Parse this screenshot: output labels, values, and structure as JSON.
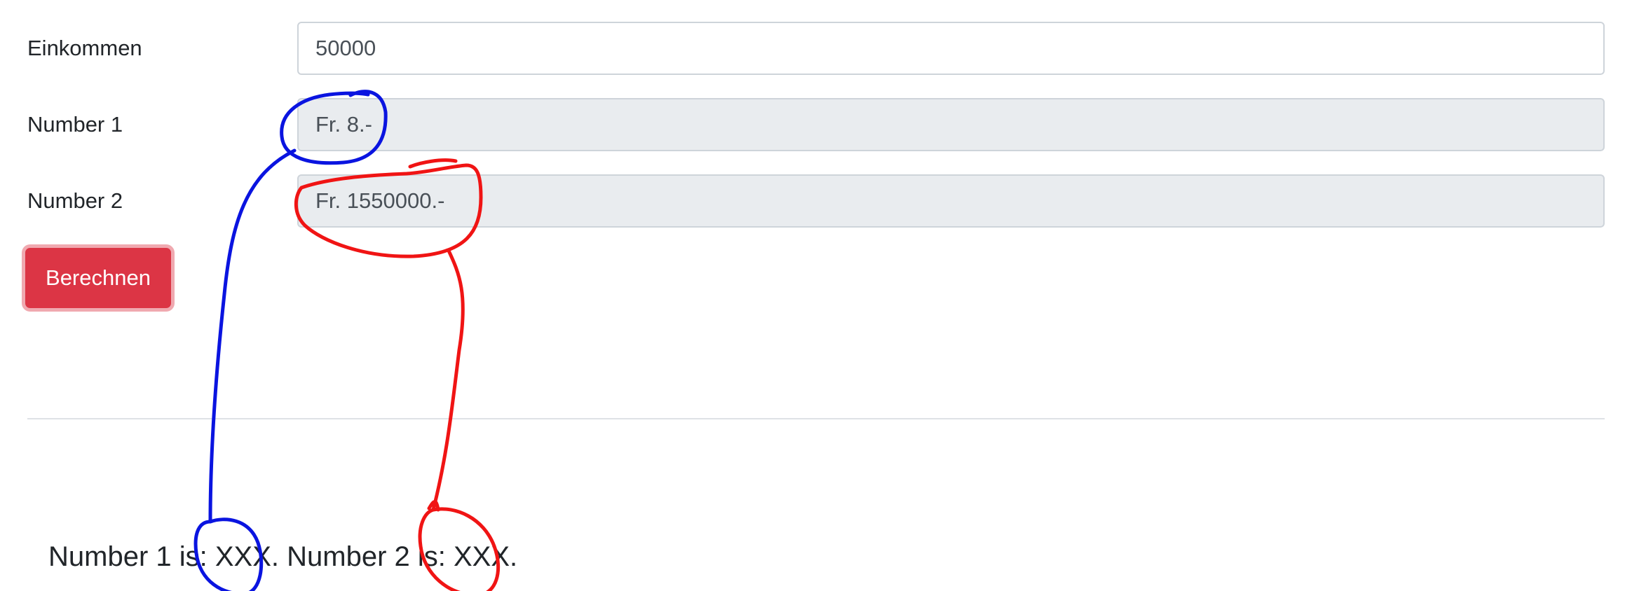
{
  "form": {
    "income": {
      "label": "Einkommen",
      "value": "50000"
    },
    "number1": {
      "label": "Number 1",
      "value": "Fr. 8.-"
    },
    "number2": {
      "label": "Number 2",
      "value": "Fr. 1550000.-"
    },
    "submit_label": "Berechnen"
  },
  "result": {
    "number1_prefix": "Number 1 is: ",
    "number1_value": "XXX.",
    "number2_prefix": " Number 2 is: ",
    "number2_value": "XXX."
  },
  "colors": {
    "accent_button": "#dc3545",
    "annotation_blue": "#0a14e0",
    "annotation_red": "#f01414"
  }
}
